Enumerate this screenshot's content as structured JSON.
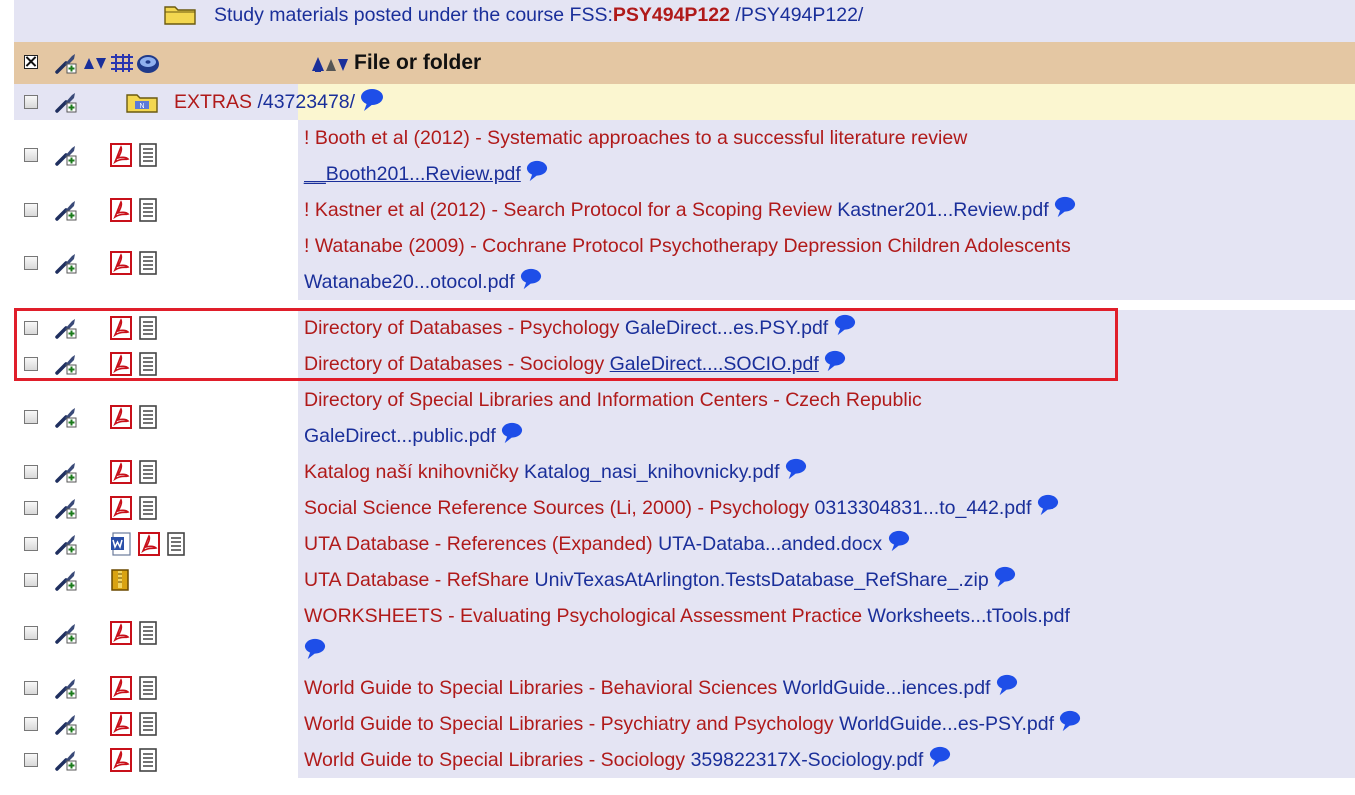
{
  "header": {
    "prefix": "Study materials posted under the course FSS:",
    "course_code": "PSY494P122",
    "path": "/PSY494P122/"
  },
  "column_header": {
    "label": "File or folder"
  },
  "folder": {
    "name": "EXTRAS",
    "path": "/43723478/"
  },
  "rows": [
    {
      "title": "! Booth et al (2012) - Systematic approaches to a successful literature review",
      "file": "__Booth201...Review.pdf"
    },
    {
      "title": "! Kastner et al (2012) - Search Protocol for a Scoping Review",
      "file": "Kastner201...Review.pdf"
    },
    {
      "title": "! Watanabe (2009) - Cochrane Protocol Psychotherapy Depression Children Adolescents",
      "file": "Watanabe20...otocol.pdf"
    },
    {
      "title": "Directory of Databases - Psychology",
      "file": "GaleDirect...es.PSY.pdf"
    },
    {
      "title": "Directory of Databases - Sociology",
      "file": "GaleDirect....SOCIO.pdf"
    },
    {
      "title": "Directory of Special Libraries and Information Centers - Czech Republic",
      "file": "GaleDirect...public.pdf"
    },
    {
      "title": "Katalog naší knihovničky",
      "file": "Katalog_nasi_knihovnicky.pdf"
    },
    {
      "title": "Social Science Reference Sources (Li, 2000) - Psychology",
      "file": "0313304831...to_442.pdf"
    },
    {
      "title": "UTA Database - References (Expanded)",
      "file": "UTA-Databa...anded.docx"
    },
    {
      "title": "UTA Database - RefShare",
      "file": "UnivTexasAtArlington.TestsDatabase_RefShare_.zip"
    },
    {
      "title": "WORKSHEETS - Evaluating Psychological Assessment Practice",
      "file": "Worksheets...tTools.pdf"
    },
    {
      "title": "World Guide to Special Libraries - Behavioral Sciences",
      "file": "WorldGuide...iences.pdf"
    },
    {
      "title": "World Guide to Special Libraries - Psychiatry and Psychology",
      "file": "WorldGuide...es-PSY.pdf"
    },
    {
      "title": "World Guide to Special Libraries - Sociology",
      "file": "359822317X-Sociology.pdf"
    }
  ],
  "icons": [
    "folder-icon",
    "select-all-checkbox",
    "tools-icon",
    "sort-arrows-icon",
    "columns-icon",
    "disk-icon",
    "pdf-icon",
    "text-document-icon",
    "word-icon",
    "archive-icon",
    "comment-icon"
  ],
  "colors": {
    "header_bg": "#e4c7a3",
    "row_bg": "#e4e4f3",
    "folder_row_bg": "#fbf6d0",
    "title_text": "#b01a1a",
    "file_link": "#1a2f9a",
    "highlight": "#e01e2a"
  }
}
